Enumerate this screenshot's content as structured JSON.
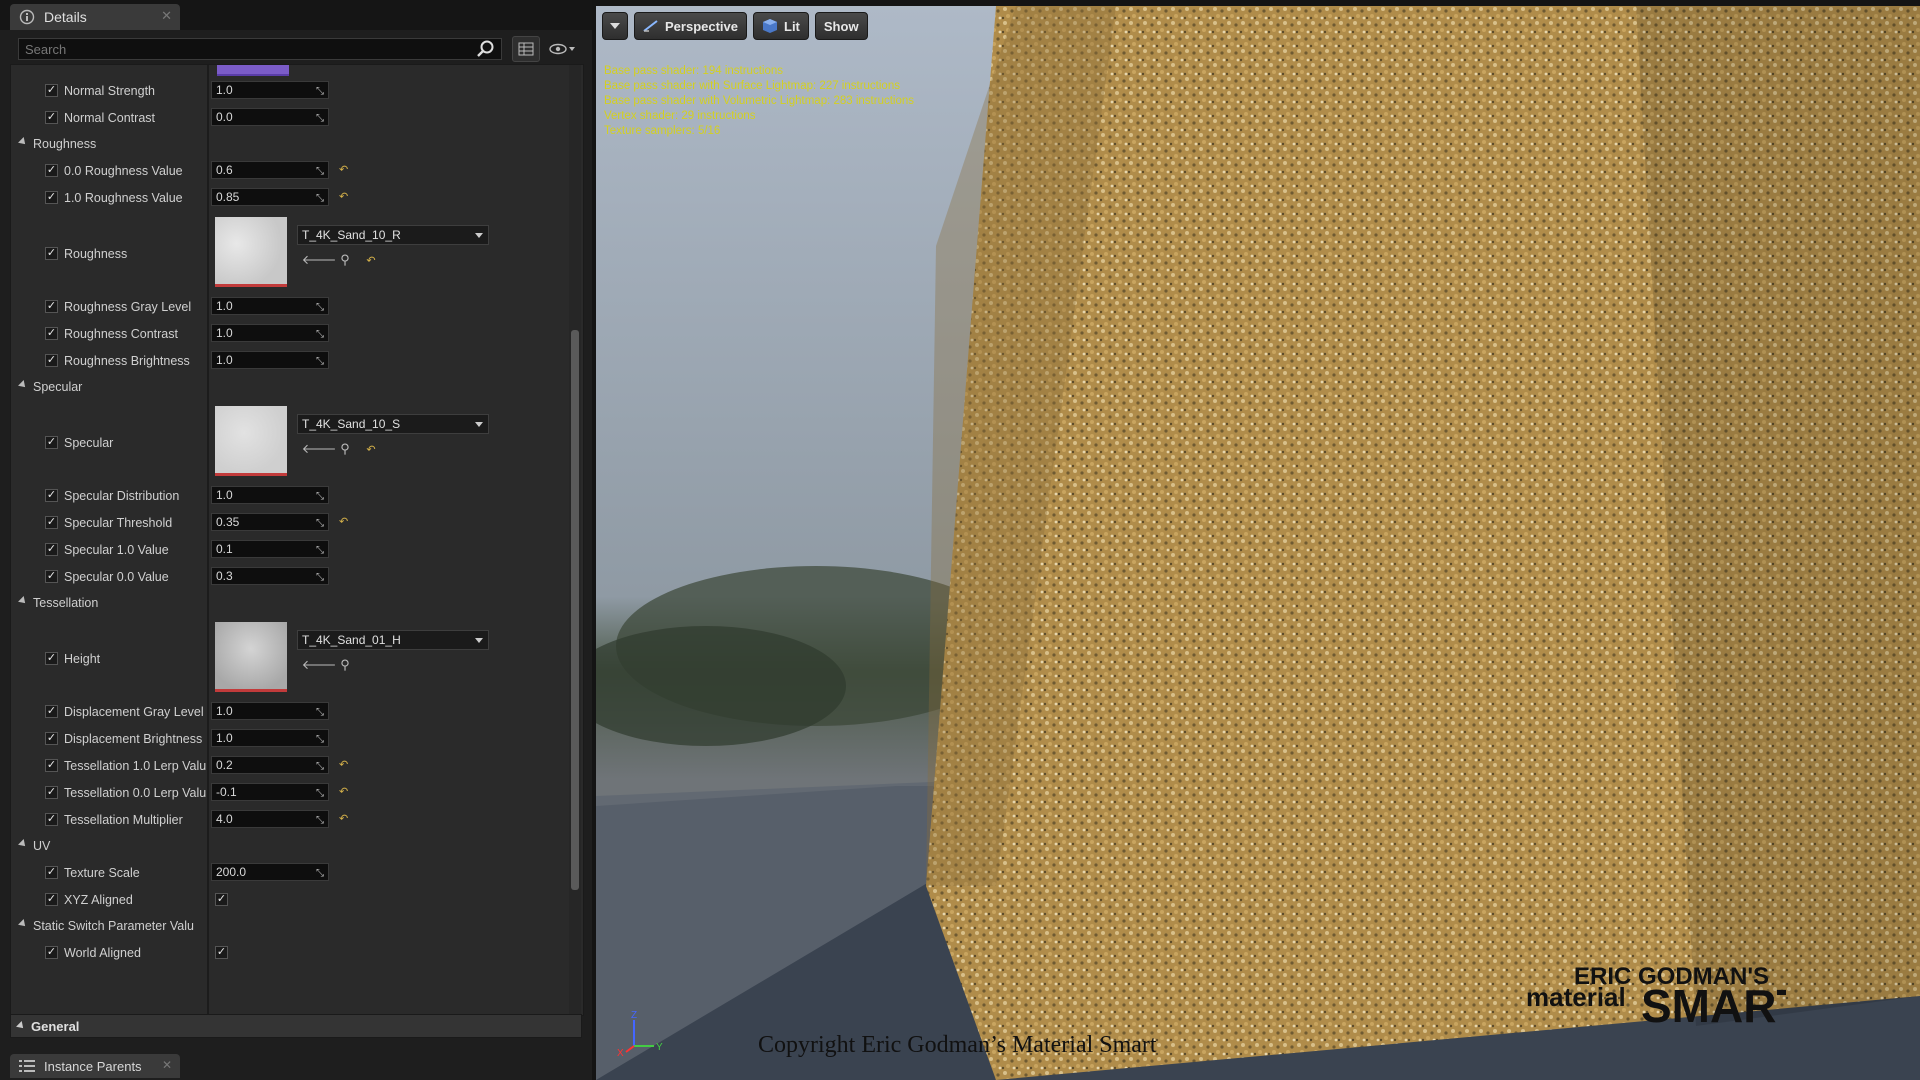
{
  "details_tab": {
    "title": "Details"
  },
  "search": {
    "placeholder": "Search"
  },
  "sections": {
    "roughness": "Roughness",
    "specular": "Specular",
    "tessellation": "Tessellation",
    "uv": "UV",
    "static_switch": "Static Switch Parameter Valu"
  },
  "rows": {
    "normal_strength": {
      "label": "Normal Strength",
      "value": "1.0"
    },
    "normal_contrast": {
      "label": "Normal Contrast",
      "value": "0.0"
    },
    "roughness_00": {
      "label": "0.0 Roughness Value",
      "value": "0.6"
    },
    "roughness_10": {
      "label": "1.0 Roughness Value",
      "value": "0.85"
    },
    "roughness_tex": {
      "label": "Roughness",
      "texture": "T_4K_Sand_10_R"
    },
    "roughness_gray": {
      "label": "Roughness Gray Level",
      "value": "1.0"
    },
    "roughness_contrast": {
      "label": "Roughness Contrast",
      "value": "1.0"
    },
    "roughness_brightness": {
      "label": "Roughness Brightness",
      "value": "1.0"
    },
    "specular_tex": {
      "label": "Specular",
      "texture": "T_4K_Sand_10_S"
    },
    "specular_distribution": {
      "label": "Specular Distribution",
      "value": "1.0"
    },
    "specular_threshold": {
      "label": "Specular Threshold",
      "value": "0.35"
    },
    "specular_10": {
      "label": "Specular 1.0 Value",
      "value": "0.1"
    },
    "specular_00": {
      "label": "Specular 0.0 Value",
      "value": "0.3"
    },
    "height_tex": {
      "label": "Height",
      "texture": "T_4K_Sand_01_H"
    },
    "displacement_gray": {
      "label": "Displacement Gray Level",
      "value": "1.0"
    },
    "displacement_brightness": {
      "label": "Displacement Brightness",
      "value": "1.0"
    },
    "tess_10": {
      "label": "Tessellation 1.0 Lerp Valu",
      "value": "0.2"
    },
    "tess_00": {
      "label": "Tessellation 0.0 Lerp Valu",
      "value": "-0.1"
    },
    "tess_mult": {
      "label": "Tessellation Multiplier",
      "value": "4.0"
    },
    "texture_scale": {
      "label": "Texture Scale",
      "value": "200.0"
    },
    "xyz_aligned": {
      "label": "XYZ Aligned"
    },
    "world_aligned": {
      "label": "World Aligned"
    }
  },
  "general": {
    "label": "General"
  },
  "instance_parents_tab": {
    "title": "Instance Parents"
  },
  "viewport": {
    "perspective": "Perspective",
    "lit": "Lit",
    "show": "Show",
    "stats": [
      "Base pass shader: 194 instructions",
      "Base pass shader with Surface Lightmap: 227 instructions",
      "Base pass shader with Volumetric Lightmap: 283 instructions",
      "Vertex shader: 29 instructions",
      "Texture samplers: 5/16"
    ],
    "axis_x": "X",
    "axis_y": "Y",
    "axis_z": "Z",
    "copyright": "Copyright Eric Godman’s Material Smart",
    "logo_line1": "ERIC GODMAN'S",
    "logo_line2a": "material",
    "logo_line2b": "SMART"
  },
  "colors": {
    "accent_reset": "#d6b24a",
    "texture_border": "#c23b3b",
    "stats_text": "#d4d020"
  }
}
